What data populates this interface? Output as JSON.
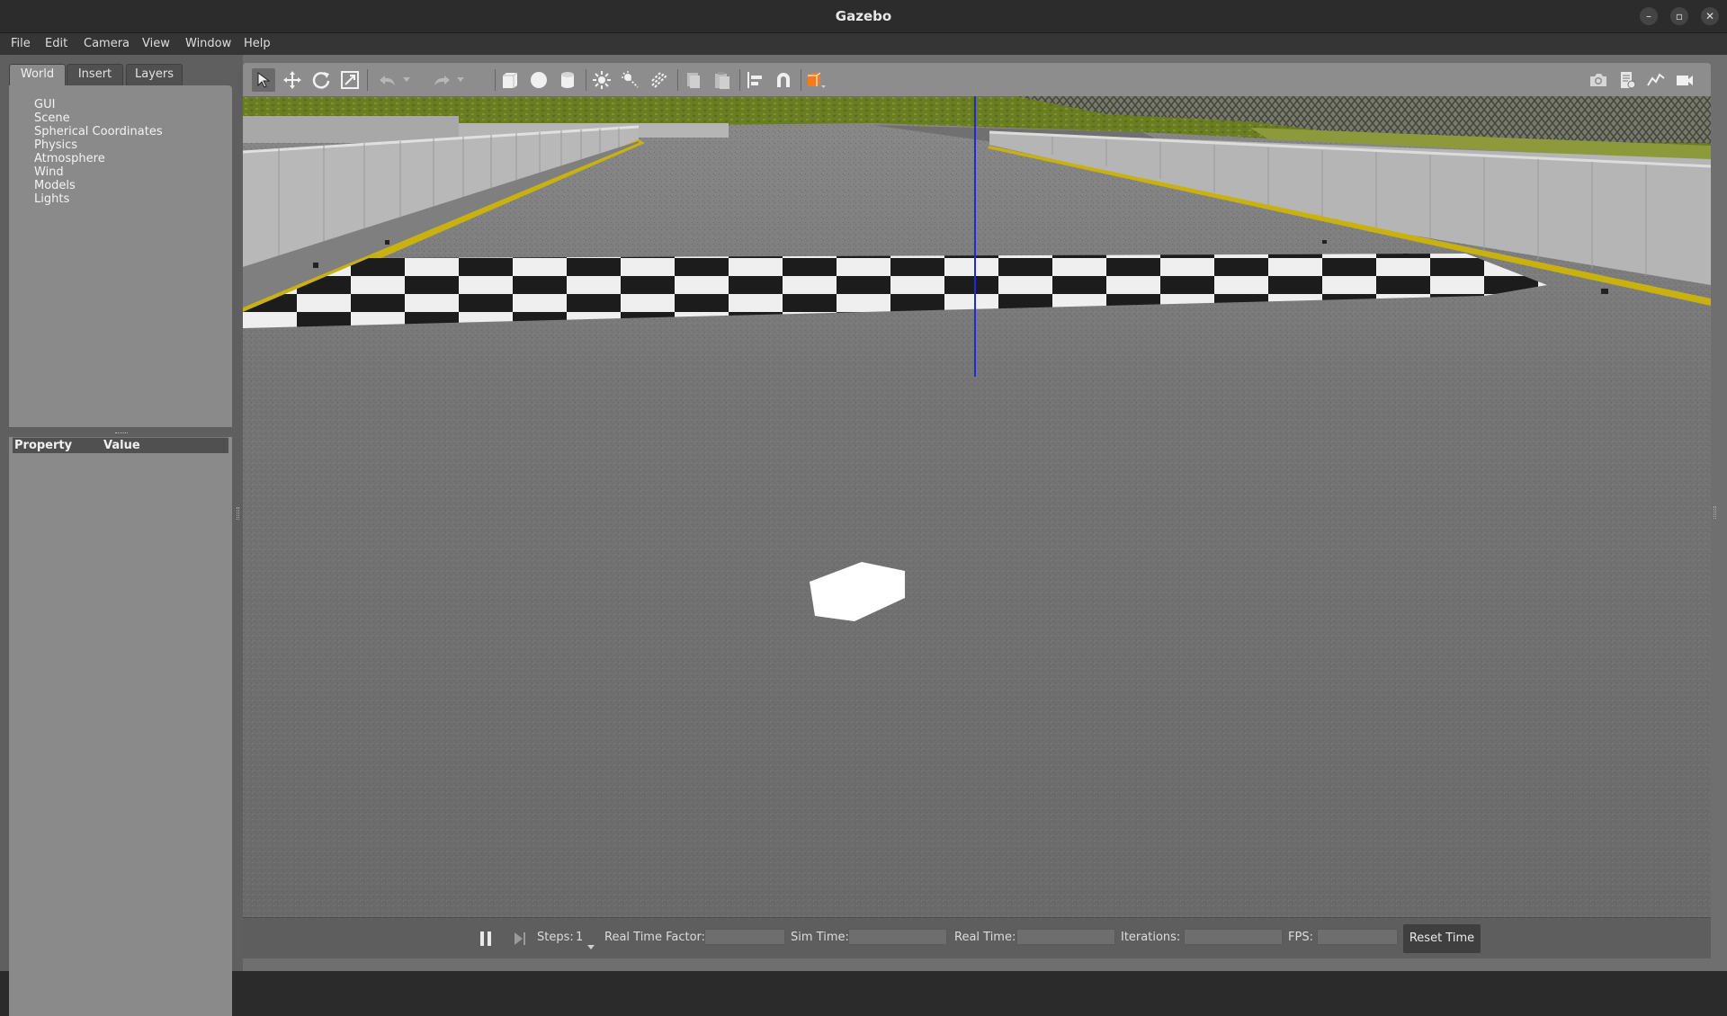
{
  "window": {
    "title": "Gazebo",
    "controls": [
      "–",
      "▫",
      "✕"
    ]
  },
  "menu": [
    {
      "label": "File"
    },
    {
      "label": "Edit"
    },
    {
      "label": "Camera"
    },
    {
      "label": "View"
    },
    {
      "label": "Window"
    },
    {
      "label": "Help"
    }
  ],
  "left_panel": {
    "tabs": [
      {
        "label": "World",
        "active": true
      },
      {
        "label": "Insert",
        "active": false
      },
      {
        "label": "Layers",
        "active": false
      }
    ],
    "tree_items": [
      "GUI",
      "Scene",
      "Spherical Coordinates",
      "Physics",
      "Atmosphere",
      "Wind",
      "Models",
      "Lights"
    ],
    "properties": {
      "col_property": "Property",
      "col_value": "Value"
    }
  },
  "toolbar": {
    "left_icons": [
      "select-arrow-icon",
      "translate-icon",
      "rotate-icon",
      "scale-icon",
      "undo-icon",
      "redo-icon",
      "box-icon",
      "sphere-icon",
      "cylinder-icon",
      "point-light-icon",
      "spot-light-icon",
      "directional-light-icon",
      "copy-icon",
      "paste-icon",
      "align-icon",
      "snap-magnet-icon",
      "view-angle-icon"
    ],
    "right_icons": [
      "screenshot-camera-icon",
      "log-icon",
      "plot-icon",
      "video-record-icon"
    ],
    "accent": "#f07c22"
  },
  "bottom_bar": {
    "steps_label": "Steps:",
    "steps_value": "1",
    "real_time_factor_label": "Real Time Factor:",
    "sim_time_label": "Sim Time:",
    "real_time_label": "Real Time:",
    "iterations_label": "Iterations:",
    "fps_label": "FPS:",
    "reset_time_label": "Reset Time",
    "real_time_factor_value": "",
    "sim_time_value": "",
    "real_time_value": "",
    "iterations_value": "",
    "fps_value": ""
  }
}
